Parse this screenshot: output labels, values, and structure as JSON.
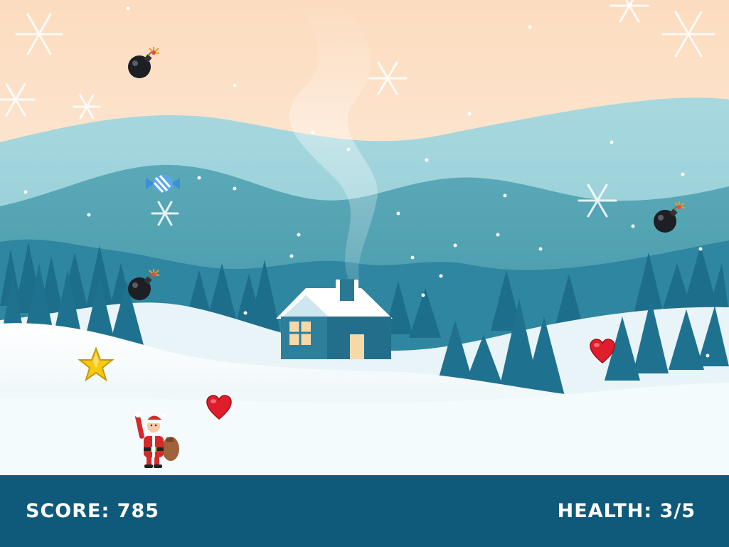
{
  "hud": {
    "score_label": "SCORE:",
    "score_value": "785",
    "health_label": "HEALTH:",
    "health_value": "3/5",
    "health_current": 3,
    "health_max": 5
  },
  "colors": {
    "sky_top": "#fbe0c4",
    "mountain_far": "#7dc4cf",
    "mountain_mid": "#3f93a6",
    "tree": "#1f6d8a",
    "snow": "#f2fafc",
    "hud_bar": "#0f5a7a",
    "hud_text": "#ffffff"
  },
  "sprites": {
    "player": "santa-claus",
    "bombs": 3,
    "hearts": 2,
    "stars": 1,
    "candies": 1
  }
}
